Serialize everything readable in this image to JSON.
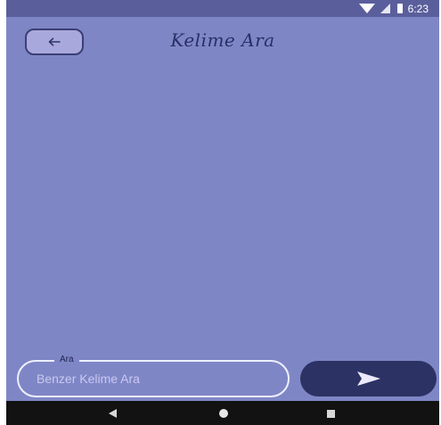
{
  "status_bar": {
    "time": "6:23",
    "icons": [
      "wifi-icon",
      "signal-icon",
      "battery-icon"
    ]
  },
  "header": {
    "back_icon": "arrow-left-icon",
    "title": "Kelime Ara"
  },
  "search": {
    "label": "Ara",
    "placeholder": "Benzer Kelime Ara",
    "value": ""
  },
  "send_button": {
    "icon": "send-icon"
  },
  "nav_bar": {
    "icons": [
      "nav-back-icon",
      "nav-home-icon",
      "nav-recent-icon"
    ]
  },
  "colors": {
    "background": "#7f86c6",
    "status_bar": "#5a5f9c",
    "title": "#2a2f66",
    "back_button_fill": "#a9a8dc",
    "send_button": "#2c3263",
    "nav_bar": "#121212"
  }
}
